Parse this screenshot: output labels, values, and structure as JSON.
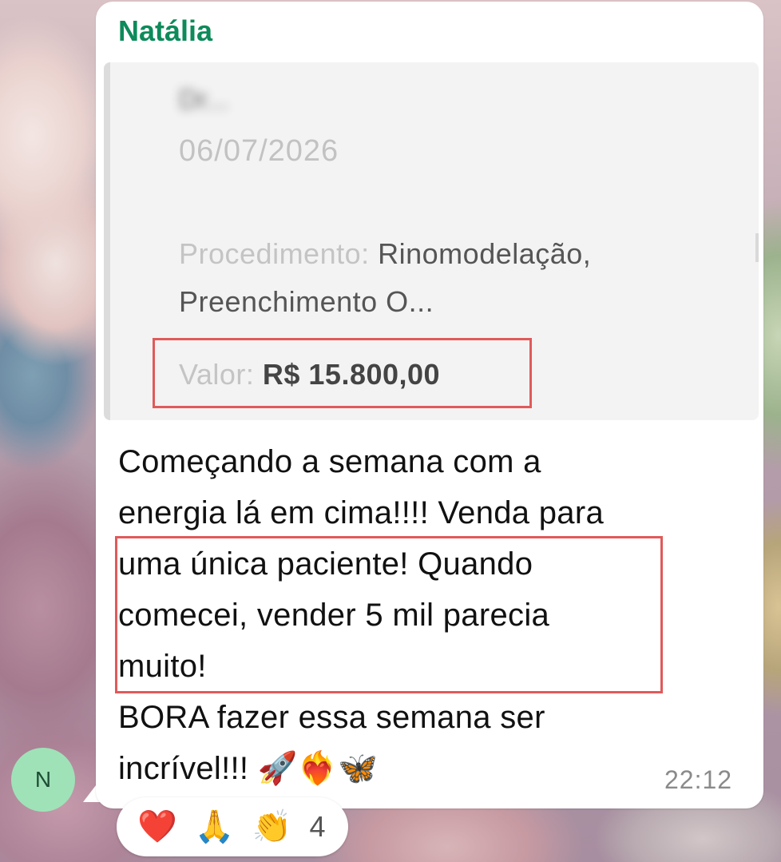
{
  "message": {
    "sender": "Natália",
    "quote": {
      "title_redacted": "Dr...",
      "date": "06/07/2026",
      "procedure_label": "Procedimento:",
      "procedure_value": "Rinomodelação,",
      "procedure_value_2": "Preenchimento O...",
      "value_label": "Valor:",
      "value_amount": "R$ 15.800,00"
    },
    "text_lines": [
      "Começando a semana com a",
      "energia lá em cima!!!! Venda para",
      "uma única paciente! Quando",
      "comecei, vender 5 mil parecia",
      "muito!",
      "BORA fazer essa semana ser",
      "incrível!!! 🚀❤️‍🔥🦋"
    ],
    "time": "22:12"
  },
  "avatar": {
    "initial": "N",
    "color": "#9fe2b8"
  },
  "reactions": {
    "emojis": [
      "❤️",
      "🙏",
      "👏"
    ],
    "count": "4"
  },
  "colors": {
    "sender": "#0e8a5b",
    "highlight_box": "#e05a5a",
    "bubble": "#ffffff"
  }
}
